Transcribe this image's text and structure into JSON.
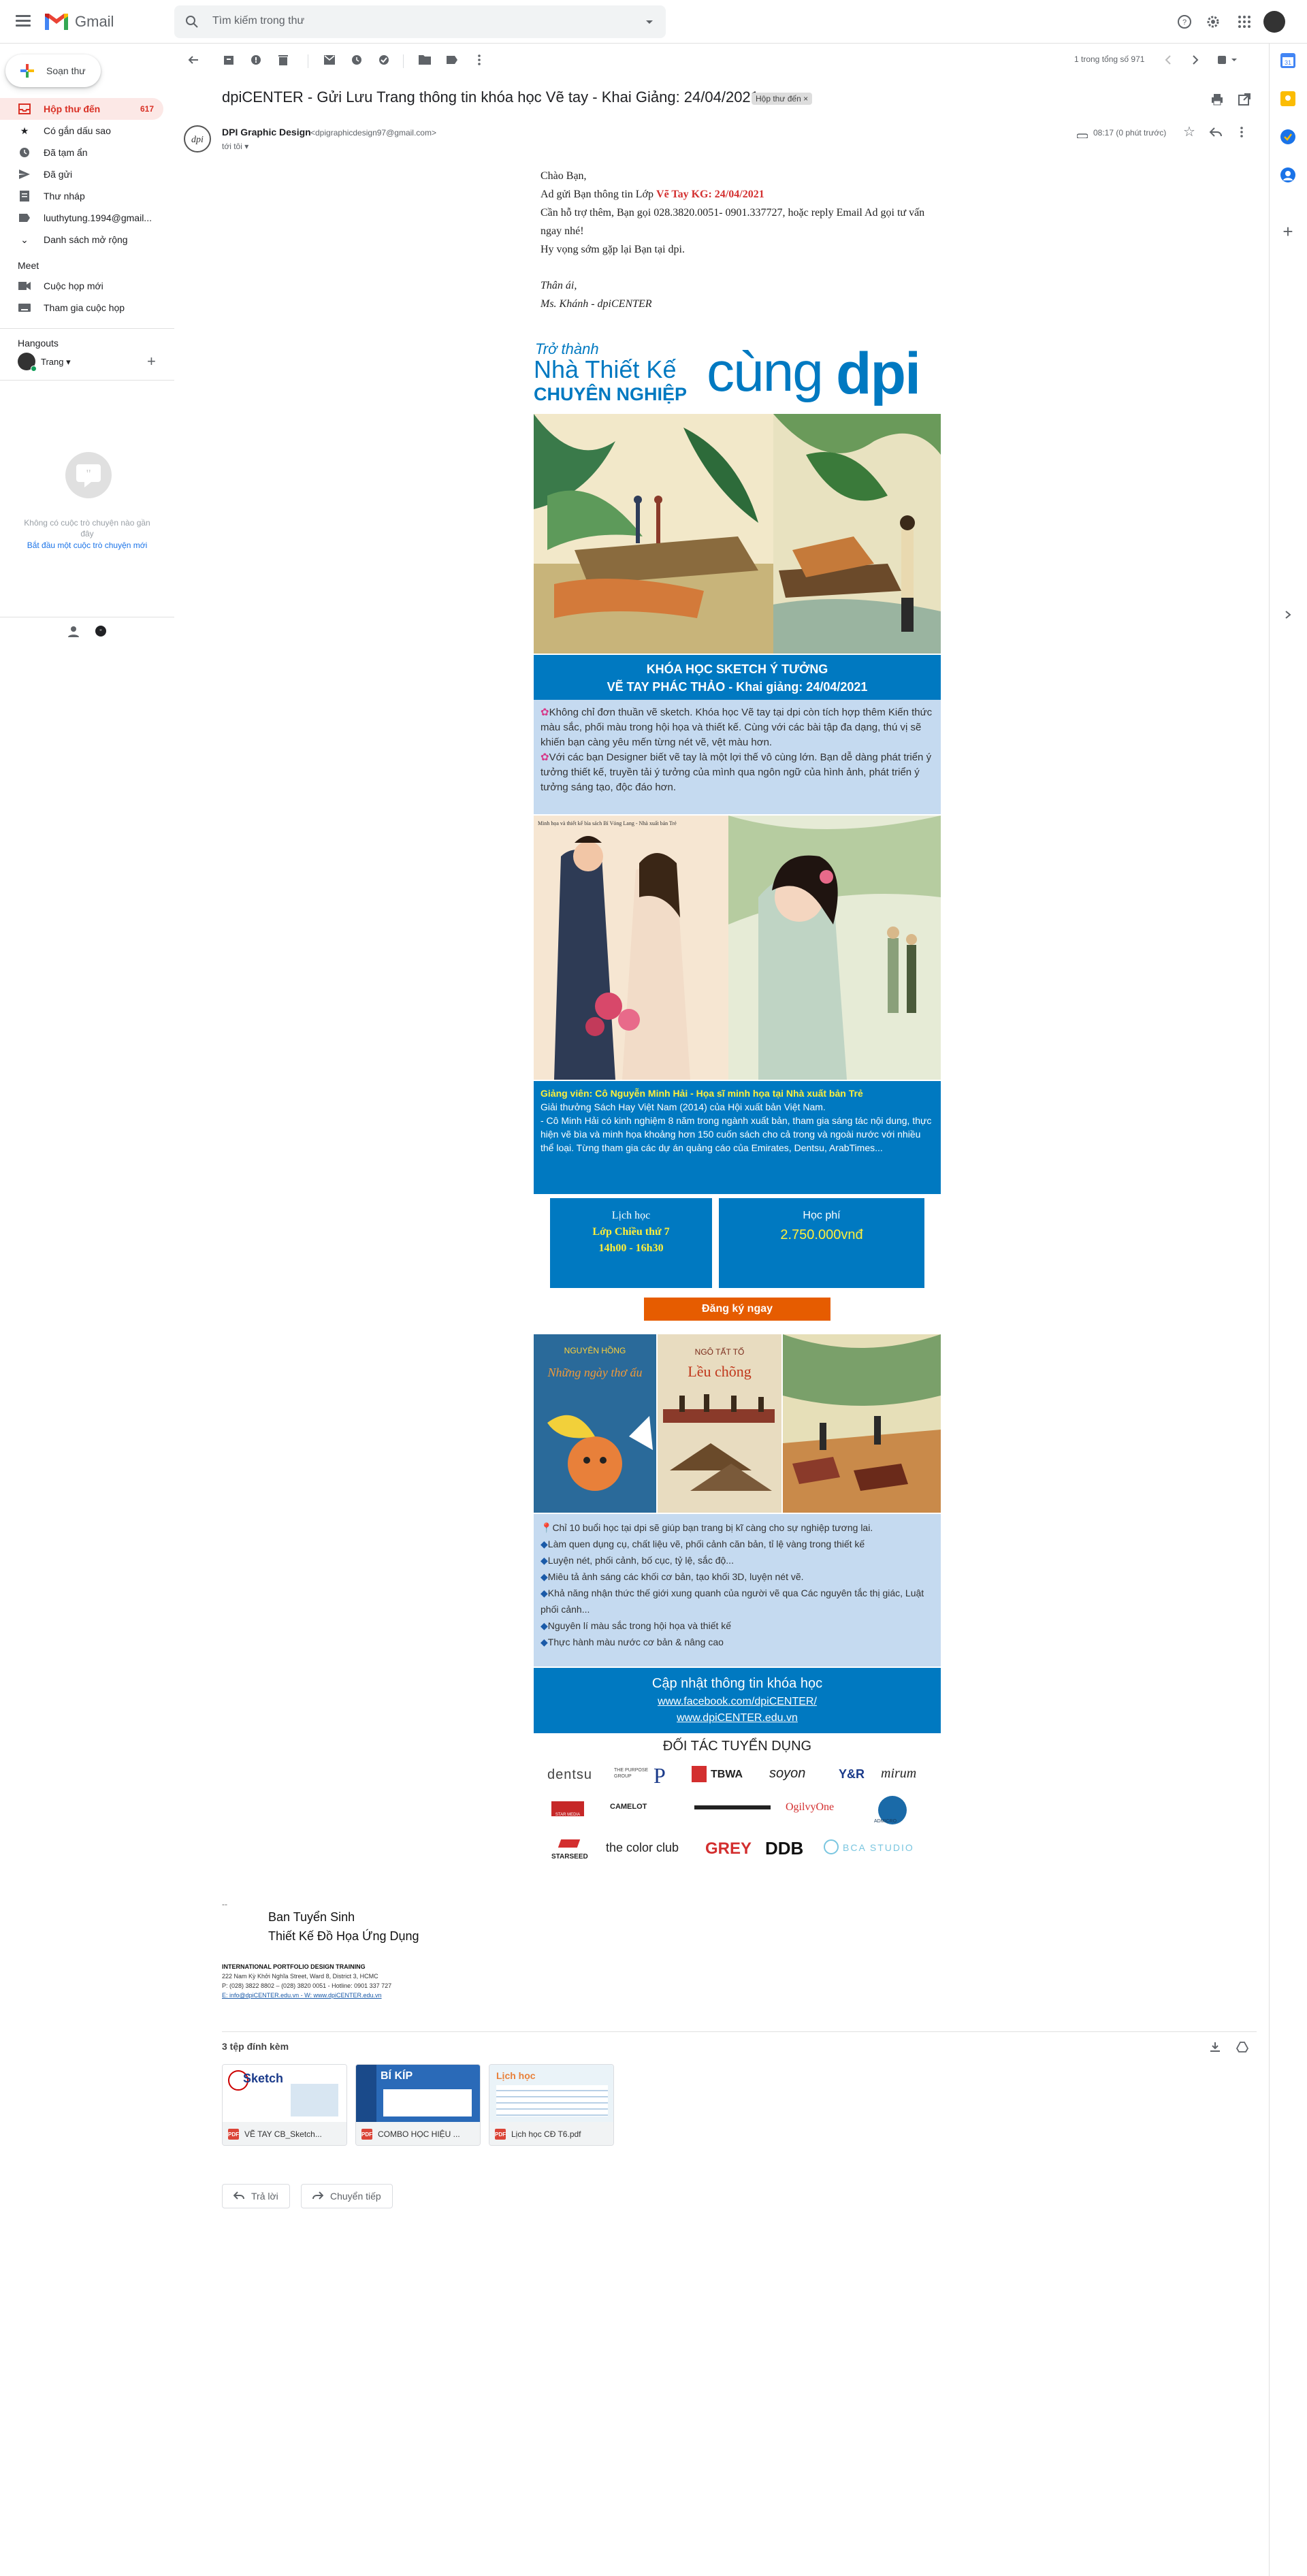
{
  "app": {
    "name": "Gmail",
    "search_placeholder": "Tìm kiếm trong thư"
  },
  "sidebar": {
    "compose_label": "Soạn thư",
    "items": [
      {
        "label": "Hộp thư đến",
        "count": "617",
        "icon": "inbox-icon"
      },
      {
        "label": "Có gắn dấu sao",
        "icon": "star-icon"
      },
      {
        "label": "Đã tạm ẩn",
        "icon": "clock-icon"
      },
      {
        "label": "Đã gửi",
        "icon": "send-icon"
      },
      {
        "label": "Thư nháp",
        "icon": "draft-icon"
      },
      {
        "label": "luuthytung.1994@gmail...",
        "icon": "label-icon"
      },
      {
        "label": "Danh sách mở rộng",
        "icon": "chevron-down-icon"
      }
    ],
    "meet_title": "Meet",
    "meet_items": [
      {
        "label": "Cuộc họp mới",
        "icon": "video-icon"
      },
      {
        "label": "Tham gia cuộc họp",
        "icon": "keyboard-icon"
      }
    ],
    "hangouts_title": "Hangouts",
    "hangouts_user": "Trang",
    "no_chats": "Không có cuộc trò chuyện nào gần đây",
    "start_chat": "Bắt đầu một cuộc trò chuyện mới"
  },
  "toolbar": {
    "pagination": "1 trong tổng số 971"
  },
  "email": {
    "subject": "dpiCENTER - Gửi Lưu Trang thông tin khóa học Vẽ tay - Khai Giảng: 24/04/2021",
    "label_badge": "Hộp thư đến ×",
    "sender_name": "DPI Graphic Design",
    "sender_email": "<dpigraphicdesign97@gmail.com>",
    "to": "tới tôi ▾",
    "time": "08:17 (0 phút trước)",
    "greeting": "Chào Bạn,",
    "line1_pre": "Ad gửi Bạn thông tin Lớp ",
    "line1_hl": "Vẽ Tay KG: 24/04/2021",
    "line2": "Cần hỗ trợ thêm, Bạn gọi 028.3820.0051- 0901.337727, hoặc reply Email Ad gọi tư vấn ngay nhé!",
    "line3": "Hy vọng sớm gặp lại Bạn tại dpi.",
    "sign1": "Thân ái,",
    "sign2": "Ms. Khánh - dpiCENTER"
  },
  "newsletter": {
    "hero_small": "Trở thành",
    "hero_big": "Nhà Thiết Kế",
    "hero_caps": "CHUYÊN NGHIỆP",
    "hero_cung": "cùng",
    "hero_dpi": "dpi",
    "course_title1": "KHÓA HỌC SKETCH Ý TƯỞNG",
    "course_title2": "VẼ TAY PHÁC THẢO - Khai giảng: 24/04/2021",
    "intro1": "Không chỉ đơn thuần vẽ sketch. Khóa học Vẽ tay tại dpi còn tích hợp thêm Kiến thức màu sắc, phối màu trong hội họa và thiết kế. Cùng với các bài tập đa dạng, thú vị sẽ khiến bạn càng yêu mến từng nét vẽ, vệt màu hơn.",
    "intro2": "Với các bạn Designer biết vẽ tay là một lợi thế vô cùng lớn. Bạn dễ dàng phát triển ý tưởng thiết kế, truyền tải ý tưởng của mình qua ngôn ngữ của hình ảnh, phát triển ý tưởng sáng tạo, độc đáo hơn.",
    "illus_caption": "Minh họa và thiết kế bìa sách Bỉ Vỏng Lang - Nhà xuất bản Trẻ",
    "teacher_title": "Giảng viên: Cô Nguyễn Minh Hải - Họa sĩ minh họa tại Nhà xuất bản Trẻ",
    "teacher_award": "Giải thưởng Sách Hay Việt Nam (2014) của Hội xuất bản Việt Nam.",
    "teacher_desc": "- Cô Minh Hải có kinh nghiệm 8 năm trong ngành xuất bản, tham gia sáng tác nội dung, thực hiện vẽ bìa và minh họa khoảng hơn 150 cuốn sách cho cả trong và ngoài nước với nhiều thể loại. Từng tham gia các dự án quảng cáo của Emirates, Dentsu, ArabTimes...",
    "schedule_title": "Lịch học",
    "schedule_day": "Lớp Chiều thứ 7",
    "schedule_time": "14h00 - 16h30",
    "fee_title": "Học phí",
    "fee_value": "2.750.000vnđ",
    "register": "Đăng ký ngay",
    "book1_title": "Những ngày thơ ấu",
    "book1_author": "NGUYÊN HỒNG",
    "book2_title": "Lều chõng",
    "book2_author": "NGÔ TẤT TỐ",
    "bullets": [
      "Chỉ 10 buổi học tại dpi sẽ giúp bạn trang bị kĩ càng cho sự nghiệp tương lai.",
      "Làm quen dụng cụ, chất liệu vẽ, phối cảnh căn bản, tỉ lệ vàng trong thiết kế",
      "Luyện nét, phối cảnh, bố cục, tỷ lệ, sắc độ...",
      "Miêu tả ảnh sáng các khối cơ bản, tạo khối 3D, luyện nét vẽ.",
      "Khả năng nhận thức thế giới xung quanh của người vẽ qua Các nguyên tắc thị giác, Luật phối cảnh...",
      "Nguyên lí màu sắc trong hội họa và thiết kế",
      "Thực hành màu nước cơ bản & nâng cao"
    ],
    "update_title": "Cập nhật thông tin khóa học",
    "facebook": "www.facebook.com/dpiCENTER/",
    "website": "www.dpiCENTER.edu.vn",
    "partners_title": "ĐỐI TÁC TUYỂN DỤNG",
    "partners": [
      [
        "dentsu",
        "THE PURPOSE GROUP",
        "TBWA",
        "soyon",
        "Y&R",
        "mirum"
      ],
      [
        "STAR MEDIA",
        "CAMELOT",
        "Mcmedia",
        "OgilvyOne",
        "ADMICRO"
      ],
      [
        "STARSEED",
        "the color club",
        "GREY",
        "DDB",
        "BCA STUDIO"
      ]
    ]
  },
  "signature": {
    "dash": "--",
    "name": "Ban Tuyển Sinh",
    "dept": "Thiết Kế Đồ Họa Ứng Dụng",
    "org": "INTERNATIONAL PORTFOLIO DESIGN TRAINING",
    "address": "222 Nam Kỳ Khởi Nghĩa Street, Ward 8, District 3, HCMC",
    "phone": "P: (028) 3822 8802 – (028) 3820 0051 - Hotline: 0901 337 727",
    "email_web": "E: info@dpiCENTER.edu.vn - W: www.dpiCENTER.edu.vn"
  },
  "attachments": {
    "title": "3 tệp đính kèm",
    "files": [
      {
        "name": "VẼ TAY CB_Sketch...",
        "preview": "Sketch"
      },
      {
        "name": "COMBO HỌC HIỆU ...",
        "preview": "BÍ KÍP"
      },
      {
        "name": "Lịch học CĐ T6.pdf",
        "preview": "Lịch học"
      }
    ]
  },
  "actions": {
    "reply": "Trả lời",
    "forward": "Chuyển tiếp"
  },
  "colors": {
    "accent_red": "#d93025",
    "dpi_blue": "#0079c1",
    "light_blue": "#c5daf0",
    "orange": "#e65c00"
  }
}
